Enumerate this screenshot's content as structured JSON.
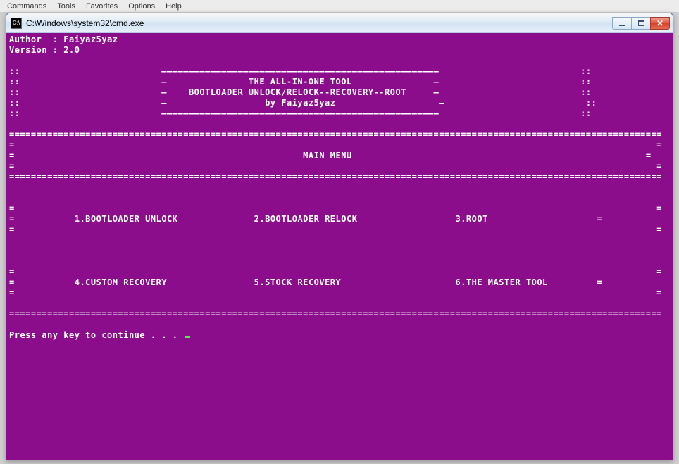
{
  "menubar": {
    "items": [
      "Commands",
      "Tools",
      "Favorites",
      "Options",
      "Help"
    ]
  },
  "window": {
    "title": "C:\\Windows\\system32\\cmd.exe",
    "icon_label": "C:\\"
  },
  "console": {
    "author_label": "Author  :",
    "author_value": "Faiyaz5yaz",
    "version_label": "Version :",
    "version_value": "2.0",
    "border_colon": "::",
    "border_dash": "–",
    "hrule_top": "–––––––––––––––––––––––––––––––––––––––––––––––––––",
    "header": {
      "title": "THE ALL-IN-ONE TOOL",
      "subtitle": "BOOTLOADER UNLOCK/RELOCK--RECOVERY--ROOT",
      "byline": "by Faiyaz5yaz"
    },
    "main_menu_label": "MAIN MENU",
    "options": {
      "opt1": "1.BOOTLOADER UNLOCK",
      "opt2": "2.BOOTLOADER RELOCK",
      "opt3": "3.ROOT",
      "opt4": "4.CUSTOM RECOVERY",
      "opt5": "5.STOCK RECOVERY",
      "opt6": "6.THE MASTER TOOL"
    },
    "prompt": "Press any key to continue . . . ",
    "eq": "=",
    "eqline": "========================================================================================================================"
  }
}
